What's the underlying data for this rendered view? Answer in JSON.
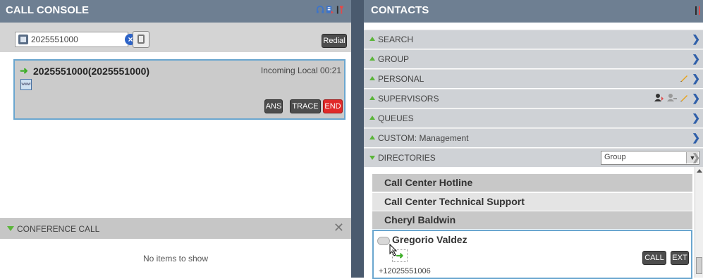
{
  "call_console": {
    "title": "CALL CONSOLE",
    "dial_value": "2025551000",
    "redial_label": "Redial",
    "call": {
      "number": "2025551000(2025551000)",
      "status": "Incoming Local 00:21",
      "ans_label": "ANS",
      "trace_label": "TRACE",
      "end_label": "END"
    },
    "conference": {
      "label": "CONFERENCE CALL",
      "empty_text": "No items to show"
    }
  },
  "contacts": {
    "title": "CONTACTS",
    "sections": [
      {
        "label": "SEARCH"
      },
      {
        "label": "GROUP"
      },
      {
        "label": "PERSONAL"
      },
      {
        "label": "SUPERVISORS"
      },
      {
        "label": "QUEUES"
      },
      {
        "label": "CUSTOM: Management"
      }
    ],
    "directories": {
      "label": "DIRECTORIES",
      "select_value": "Group",
      "items": [
        {
          "name": "Call Center Hotline"
        },
        {
          "name": "Call Center Technical Support"
        },
        {
          "name": "Cheryl Baldwin"
        }
      ],
      "selected_contact": {
        "name": "Gregorio Valdez",
        "phone": "+12025551006",
        "call_label": "CALL",
        "ext_label": "EXT"
      }
    }
  },
  "colors": {
    "header_bg": "#6e7f92",
    "accent_green": "#5bb53a",
    "end_red": "#e02a2a",
    "link_blue": "#2f5fa9",
    "highlight_border": "#6aa6cf"
  }
}
